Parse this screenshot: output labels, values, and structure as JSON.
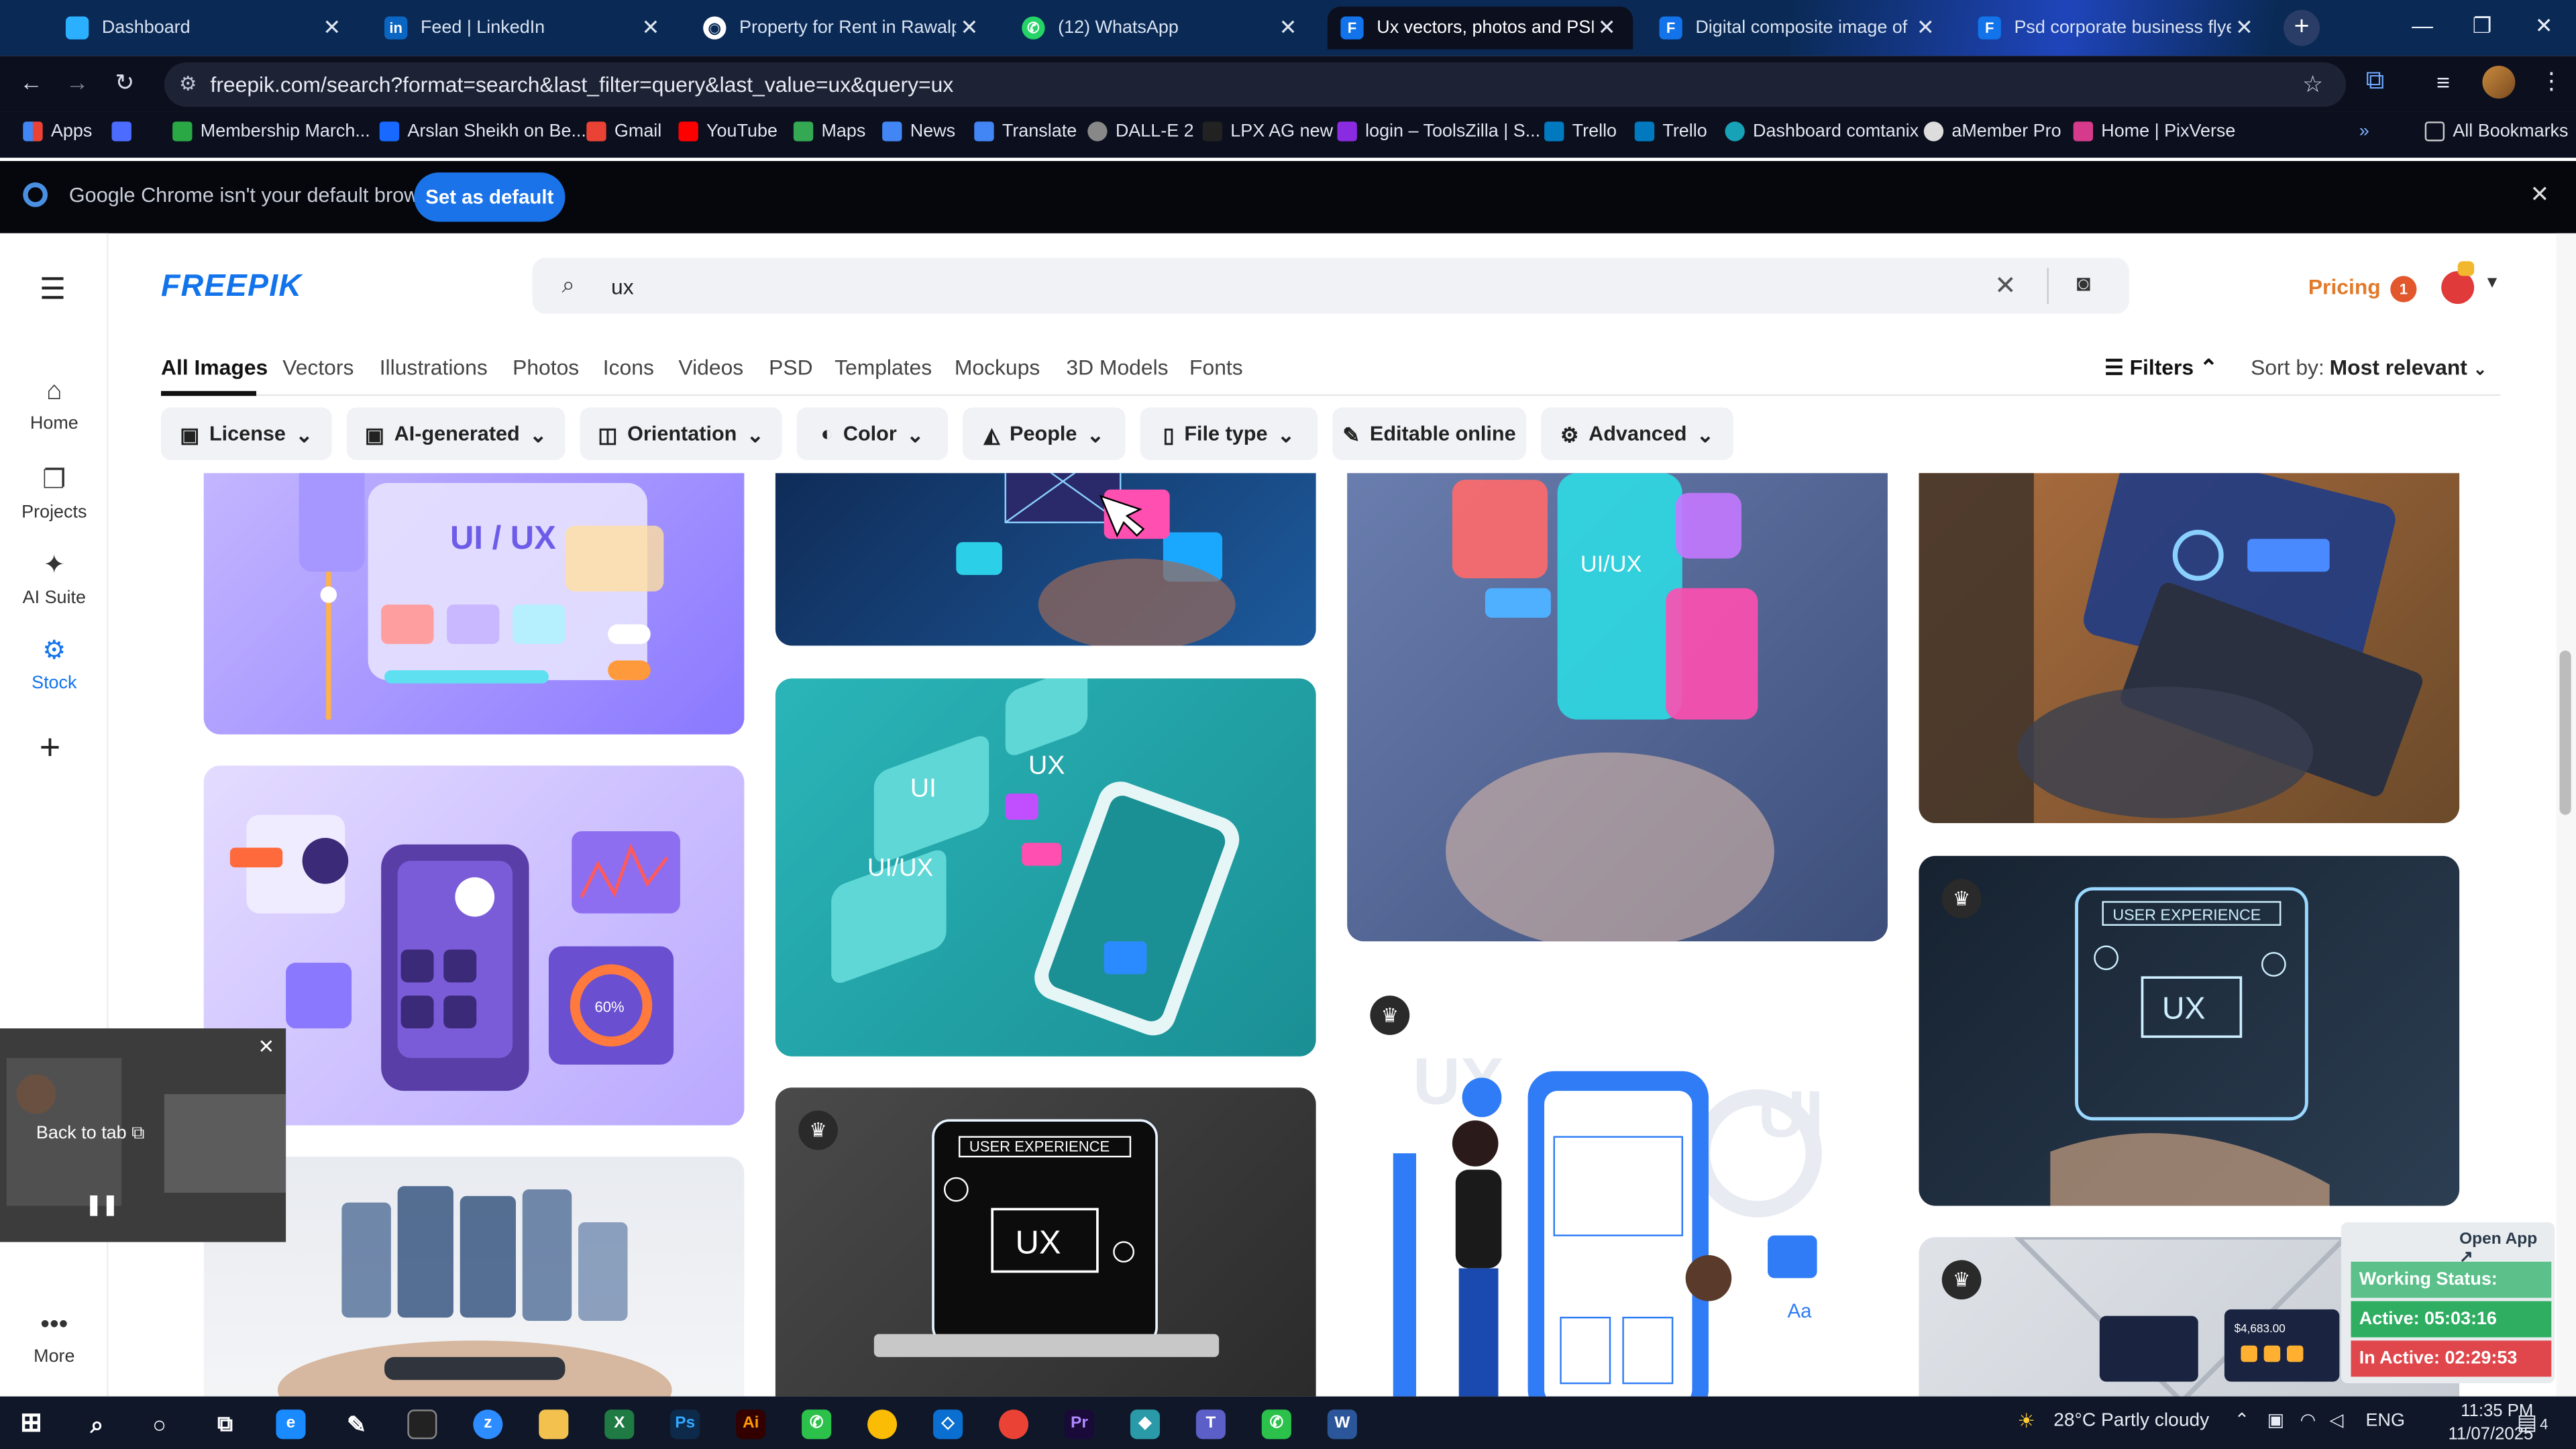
{
  "browser": {
    "tabs": [
      {
        "title": "Dashboard",
        "icon": "dashboard-icon",
        "color": "#2bb0ff"
      },
      {
        "title": "Feed | LinkedIn",
        "icon": "linkedin-icon",
        "color": "#0a66c2"
      },
      {
        "title": "Property for Rent in Rawalpindi",
        "icon": "globe-icon",
        "color": "#ffffff"
      },
      {
        "title": "(12) WhatsApp",
        "icon": "whatsapp-icon",
        "color": "#25d366"
      },
      {
        "title": "Ux vectors, photos and PSD files",
        "icon": "freepik-icon",
        "color": "#1273eb"
      },
      {
        "title": "Digital composite image of gra...",
        "icon": "freepik-icon",
        "color": "#1273eb"
      },
      {
        "title": "Psd corporate business flyer de",
        "icon": "freepik-icon",
        "color": "#1273eb"
      }
    ],
    "url": "freepik.com/search?format=search&last_filter=query&last_value=ux&query=ux",
    "bookmarks": [
      {
        "label": "Apps"
      },
      {
        "label": "Membership March..."
      },
      {
        "label": "Arslan Sheikh on Be..."
      },
      {
        "label": "Gmail"
      },
      {
        "label": "YouTube"
      },
      {
        "label": "Maps"
      },
      {
        "label": "News"
      },
      {
        "label": "Translate"
      },
      {
        "label": "DALL-E 2"
      },
      {
        "label": "LPX AG new"
      },
      {
        "label": "login – ToolsZilla | S..."
      },
      {
        "label": "Trello"
      },
      {
        "label": "Trello"
      },
      {
        "label": "Dashboard comtanix"
      },
      {
        "label": "aMember Pro"
      },
      {
        "label": "Home | PixVerse"
      }
    ],
    "all_bookmarks": "All Bookmarks",
    "infobar_text": "Google Chrome isn't your default browser",
    "set_default": "Set as default"
  },
  "sidebar": {
    "items": [
      {
        "label": "Home"
      },
      {
        "label": "Projects"
      },
      {
        "label": "AI Suite"
      },
      {
        "label": "Stock"
      }
    ],
    "more": "More"
  },
  "header": {
    "logo": "FREEPIK",
    "search_value": "ux",
    "pricing": "Pricing",
    "notif_count": "1"
  },
  "categories": [
    {
      "label": "All Images"
    },
    {
      "label": "Vectors"
    },
    {
      "label": "Illustrations"
    },
    {
      "label": "Photos"
    },
    {
      "label": "Icons"
    },
    {
      "label": "Videos"
    },
    {
      "label": "PSD"
    },
    {
      "label": "Templates"
    },
    {
      "label": "Mockups"
    },
    {
      "label": "3D Models"
    },
    {
      "label": "Fonts"
    }
  ],
  "filters_label": "Filters",
  "sort": {
    "label": "Sort by:",
    "value": "Most relevant"
  },
  "chips": [
    {
      "label": "License"
    },
    {
      "label": "AI-generated"
    },
    {
      "label": "Orientation"
    },
    {
      "label": "Color"
    },
    {
      "label": "People"
    },
    {
      "label": "File type"
    },
    {
      "label": "Editable online"
    },
    {
      "label": "Advanced"
    }
  ],
  "cards": {
    "c1_text": "UI / UX",
    "c4_ui": "UI",
    "c4_ux": "UX",
    "c4_uiux": "UI/UX",
    "c5_text": "UI/UX",
    "c7_title": "USER EXPERIENCE",
    "c7_ux": "UX",
    "c8_title": "USER EXPERIENCE",
    "c8_ux": "UX",
    "c9_ux": "UX",
    "c9_ui": "UI",
    "c9_aa": "Aa",
    "c2_percent": "60%",
    "c12_value": "$4,683.00"
  },
  "pip": {
    "back_to_tab": "Back to tab"
  },
  "status_widget": {
    "open_app": "Open App ↗",
    "working": "Working Status: Active",
    "active": "Active: 05:03:16",
    "inactive": "In Active: 02:29:53",
    "colors": {
      "working": "#5bc08a",
      "active": "#2fae62",
      "inactive": "#e0474c"
    }
  },
  "taskbar": {
    "weather_temp": "28°C",
    "weather_text": "Partly cloudy",
    "lang": "ENG",
    "time": "11:35 PM",
    "date": "11/07/2025",
    "notif": "4"
  }
}
